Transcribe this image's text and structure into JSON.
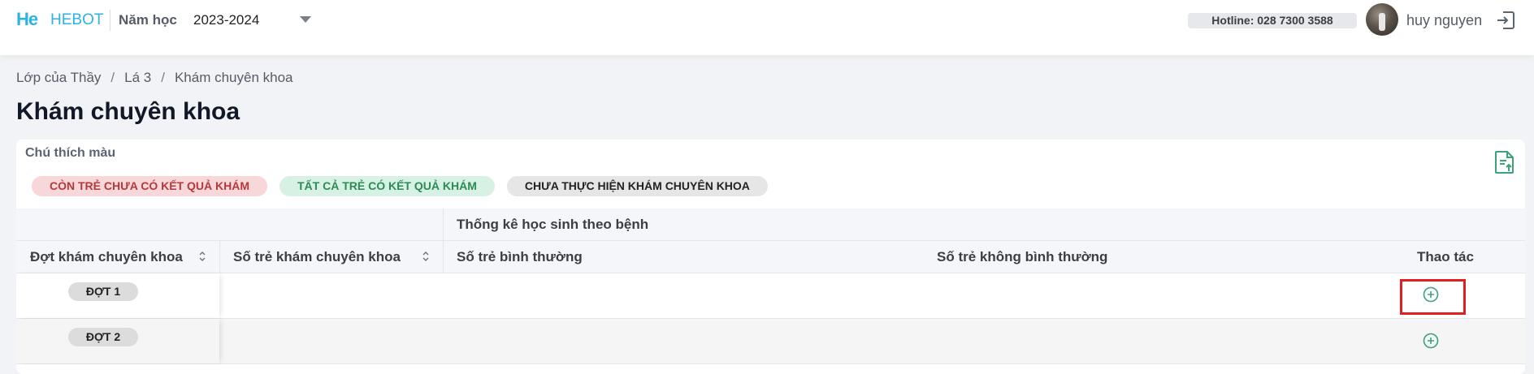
{
  "header": {
    "logo_text": "He",
    "brand": "HEBOT",
    "year_label": "Năm học",
    "year_value": "2023-2024",
    "hotline": "Hotline: 028 7300 3588",
    "username": "huy nguyen"
  },
  "breadcrumb": [
    "Lớp của Thầy",
    "Lá 3",
    "Khám chuyên khoa"
  ],
  "breadcrumb_sep": "/",
  "page_title": "Khám chuyên khoa",
  "legend": {
    "title": "Chú thích màu",
    "items": [
      {
        "label": "Còn trẻ chưa có kết quả khám",
        "color": "#f8d7da"
      },
      {
        "label": "Tất cả trẻ có kết quả khám",
        "color": "#d8f1e5"
      },
      {
        "label": "Chưa thực hiện khám chuyên khoa",
        "color": "#e6e6e6"
      }
    ]
  },
  "table": {
    "group_header": "Thống kê học sinh theo bệnh",
    "columns": [
      "Đợt khám chuyên khoa",
      "Số trẻ khám chuyên khoa",
      "Số trẻ bình thường",
      "Số trẻ không bình thường",
      "Thao tác"
    ],
    "rows": [
      {
        "batch": "ĐỢT 1",
        "examined": "",
        "normal": "",
        "abnormal": ""
      },
      {
        "batch": "ĐỢT 2",
        "examined": "",
        "normal": "",
        "abnormal": ""
      }
    ]
  },
  "icons": {
    "caret": "chevron-down-icon",
    "logout": "logout-icon",
    "export": "file-export-icon",
    "add": "plus-circle-icon",
    "sort": "sort-icon"
  },
  "colors": {
    "brand": "#2bb3e6",
    "action": "#3aa37a",
    "highlight": "#e02020"
  }
}
